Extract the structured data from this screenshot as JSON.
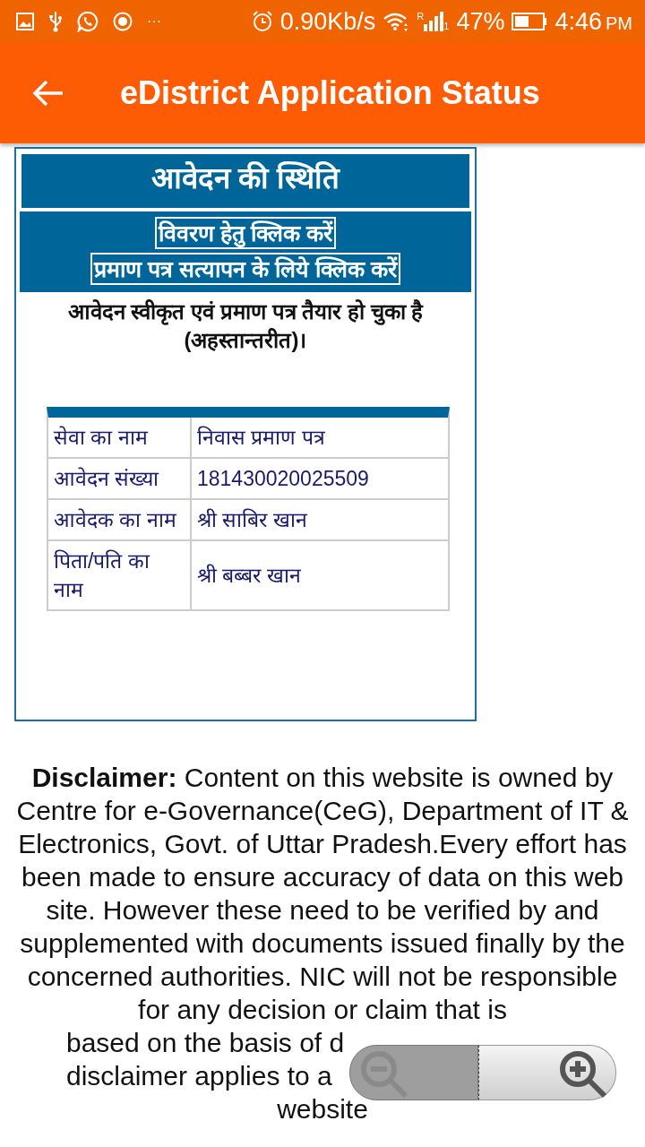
{
  "status_bar": {
    "overflow": "···",
    "network_speed": "0.90Kb/s",
    "signal_roaming": "R",
    "signal_sim": "1",
    "battery": "47%",
    "time": "4:46",
    "time_suffix": "PM"
  },
  "app_bar": {
    "title": "eDistrict Application Status"
  },
  "status_panel": {
    "heading": "आवेदन की स्थिति",
    "links": [
      "विवरण हेतु क्लिक करें",
      "प्रमाण पत्र सत्यापन के लिये क्लिक करें"
    ],
    "message": "आवेदन स्वीकृत एवं प्रमाण पत्र तैयार हो चुका है (अहस्तान्तरीत)।",
    "table": {
      "rows": [
        {
          "label": "सेवा का नाम",
          "value": "निवास प्रमाण पत्र"
        },
        {
          "label": "आवेदन संख्या",
          "value": "181430020025509"
        },
        {
          "label": "आवेदक का नाम",
          "value": "श्री साबिर खान"
        },
        {
          "label": "पिता/पति का नाम",
          "value": "श्री बब्बर खान"
        }
      ]
    }
  },
  "disclaimer": {
    "text": "**Disclaimer:** Content on this website is owned by Centre for e-Governance(CeG), Department of IT & Electronics, Govt. of Uttar Pradesh.Every effort has been made to ensure accuracy of data on this web site. However these need to be verified by and supplemented with documents issued finally by the concerned authorities. NIC will not be responsible for any decision or claim that is",
    "fragments": [
      "based on the basis of d",
      "disclaimer applies to a",
      "website"
    ]
  }
}
